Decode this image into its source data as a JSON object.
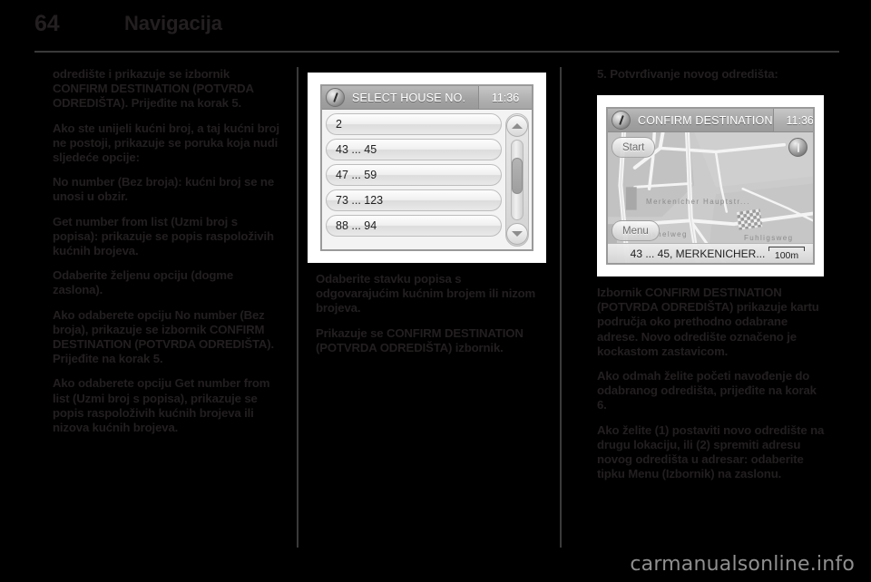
{
  "header": {
    "page_number": "64",
    "title": "Navigacija"
  },
  "column_left": {
    "paragraphs": [
      "odredište i prikazuje se izbornik CONFIRM DESTINATION (POTVRDA ODREDIŠTA). Prijeđite na korak 5.",
      "Ako ste unijeli kućni broj, a taj kućni broj ne postoji, prikazuje se poruka koja nudi sljedeće opcije:",
      "No number (Bez broja): kućni broj se ne unosi u obzir.",
      "Get number from list (Uzmi broj s popisa): prikazuje se popis raspoloživih kućnih brojeva.",
      "Odaberite željenu opciju (dogme zaslona).",
      "Ako odaberete opciju No number (Bez broja), prikazuje se izbornik CONFIRM DESTINATION (POTVRDA ODREDIŠTA). Prijeđite na korak 5.",
      "Ako odaberete opciju Get number from list (Uzmi broj s popisa), prikazuje se popis raspoloživih kućnih brojeva ili nizova kućnih brojeva."
    ]
  },
  "column_middle": {
    "paragraphs": [
      "Odaberite stavku popisa s odgovarajućim kućnim brojem ili nizom brojeva.",
      "Prikazuje se CONFIRM DESTINATION (POTVRDA ODREDIŠTA) izbornik."
    ]
  },
  "column_right": {
    "step_heading": "5. Potvrđivanje novog odredišta:",
    "paragraphs": [
      "Izbornik CONFIRM DESTINATION (POTVRDA ODREDIŠTA) prikazuje kartu područja oko prethodno odabrane adrese. Novo odredište označeno je kockastom zastavicom.",
      "Ako odmah želite početi navođenje do odabranog odredišta, prijeđite na korak 6.",
      "Ako želite (1) postaviti novo odredište na drugu lokaciju, ili (2) spremiti adresu novog odredišta u adresar: odaberite tipku Menu (Izbornik) na zaslonu."
    ]
  },
  "figure_list": {
    "icon": "info-icon",
    "title": "SELECT HOUSE NO.",
    "clock": "11:36",
    "items": [
      "2",
      "43 ... 45",
      "47 ... 59",
      "73 ... 123",
      "88 ... 94"
    ],
    "scroll_up_icon": "chevron-up-icon",
    "scroll_down_icon": "chevron-down-icon"
  },
  "figure_map": {
    "icon": "info-icon",
    "title": "CONFIRM DESTINATION",
    "clock": "11:36",
    "start_button": "Start",
    "menu_button": "Menu",
    "map_labels": [
      "Merkenicher Hauptstr...",
      "Fuhligsweg",
      "Ivenshelweg"
    ],
    "status_address": "43 ... 45, MERKENICHER...",
    "scale": "100m"
  },
  "watermark": "carmanualsonline.info",
  "colors": {
    "ink": "#231f20",
    "rule": "#3a3a3a",
    "paper": "#000000",
    "watermark": "#8f8f8f"
  }
}
